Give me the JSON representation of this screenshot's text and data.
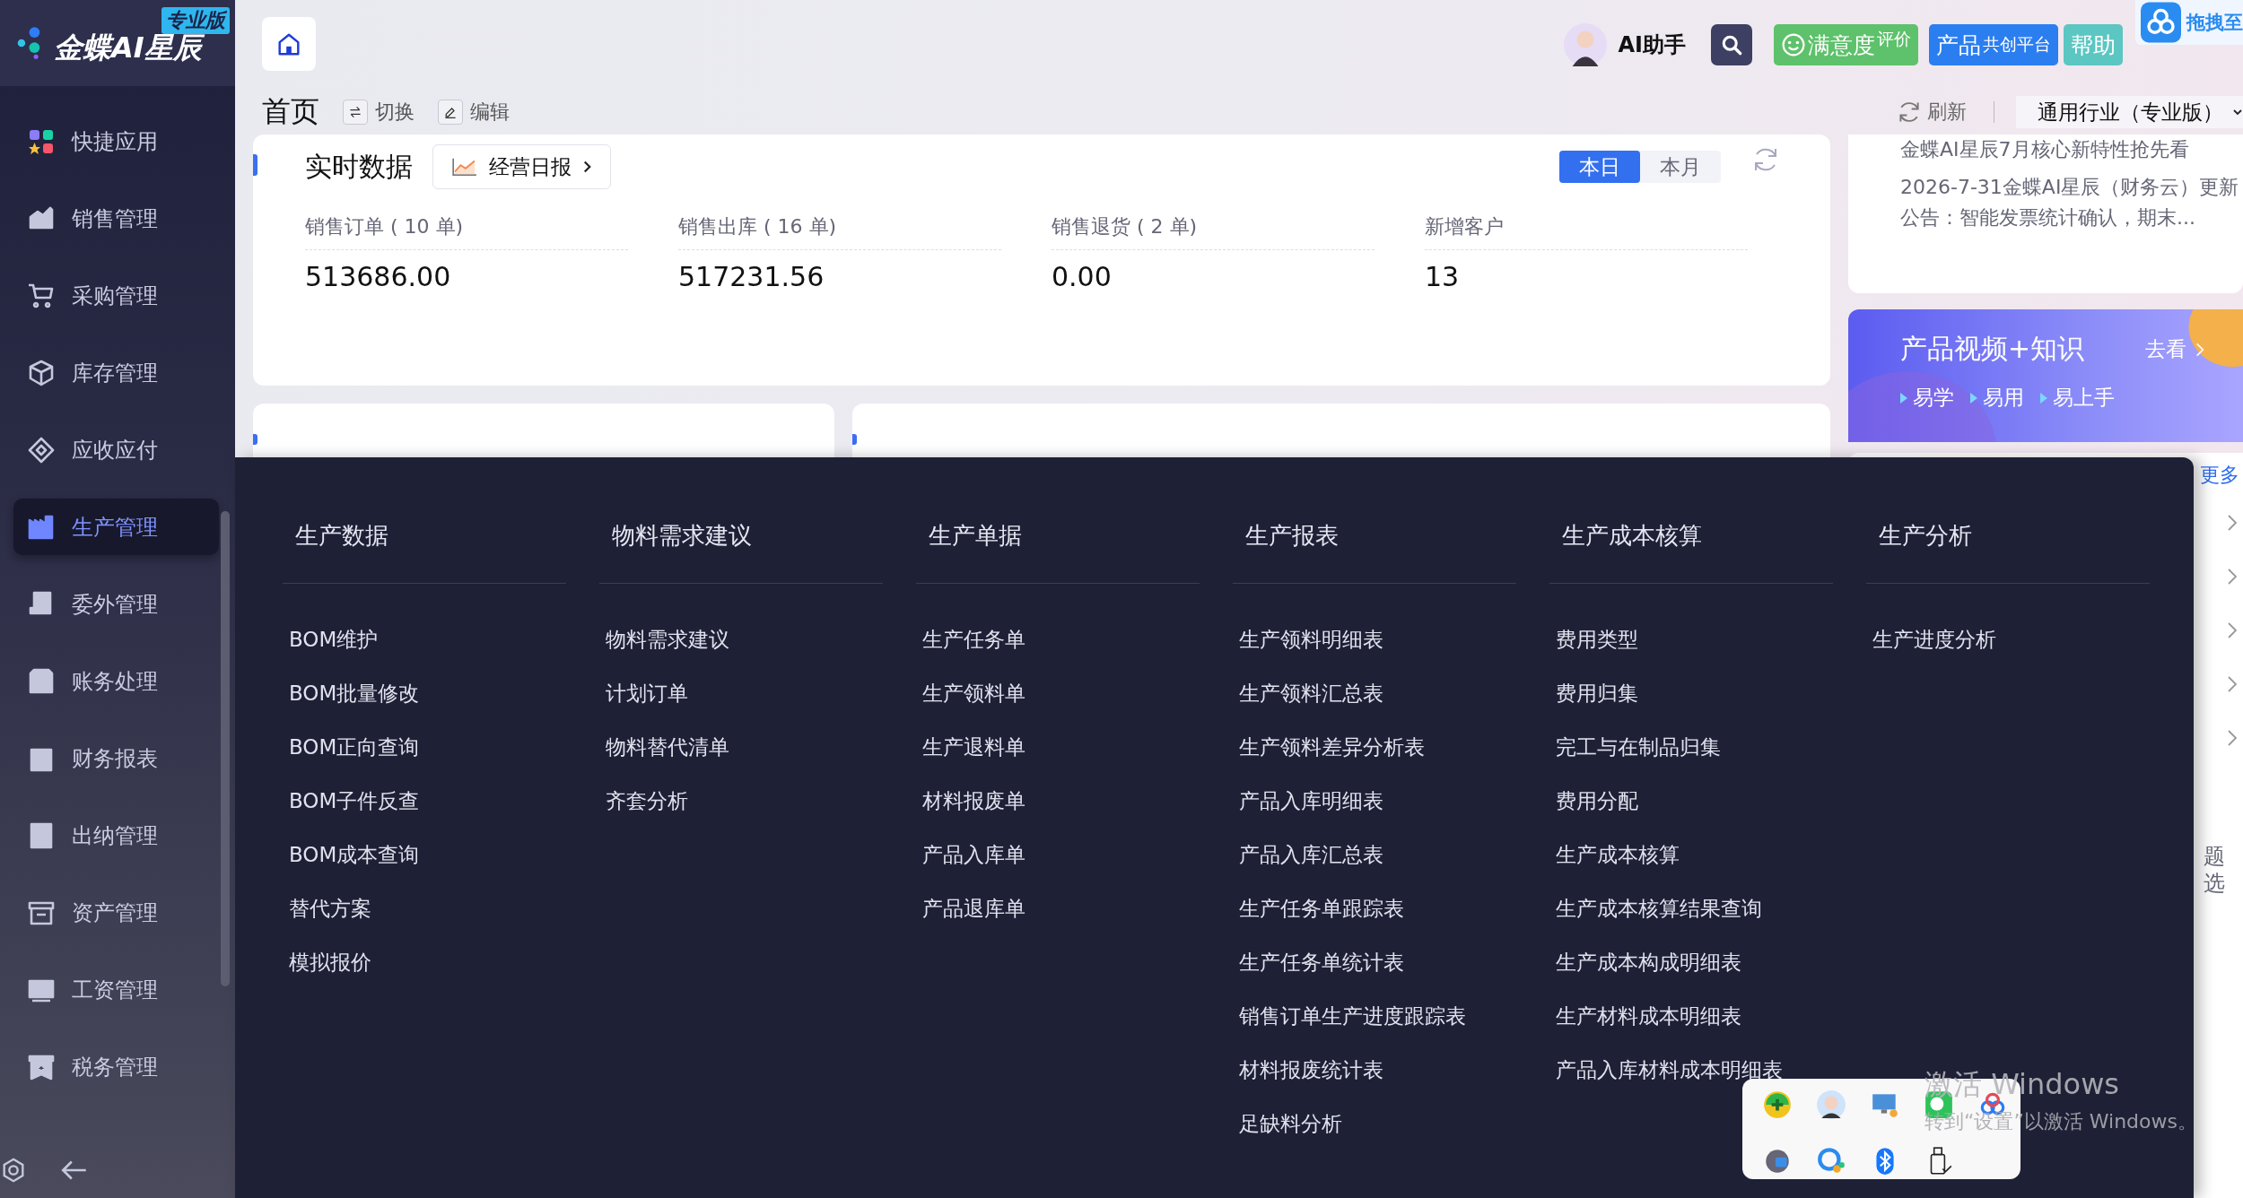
{
  "brand": {
    "name": "金蝶AI星辰",
    "edition": "专业版"
  },
  "sidebar": {
    "items": [
      {
        "label": "快捷应用",
        "selected": false
      },
      {
        "label": "销售管理",
        "selected": false
      },
      {
        "label": "采购管理",
        "selected": false
      },
      {
        "label": "库存管理",
        "selected": false
      },
      {
        "label": "应收应付",
        "selected": false
      },
      {
        "label": "生产管理",
        "selected": true
      },
      {
        "label": "委外管理",
        "selected": false
      },
      {
        "label": "账务处理",
        "selected": false
      },
      {
        "label": "财务报表",
        "selected": false
      },
      {
        "label": "出纳管理",
        "selected": false
      },
      {
        "label": "资产管理",
        "selected": false
      },
      {
        "label": "工资管理",
        "selected": false
      },
      {
        "label": "税务管理",
        "selected": false
      }
    ]
  },
  "header": {
    "page_title": "首页",
    "actions": [
      {
        "kind": "switch",
        "label": "切换"
      },
      {
        "kind": "edit",
        "label": "编辑"
      }
    ],
    "ai_assistant": "AI助手",
    "buttons": [
      {
        "kind": "rating",
        "label": "满意度",
        "small": "评价"
      },
      {
        "kind": "platform",
        "label": "产品",
        "small": "共创平台"
      },
      {
        "kind": "help",
        "label": "帮助"
      }
    ],
    "drag_hint": "拖拽至",
    "refresh": "刷新",
    "organization": "通用行业（专业版）"
  },
  "realtime": {
    "title": "实时数据",
    "report_button": "经营日报",
    "periods": [
      {
        "label": "本日",
        "selected": true
      },
      {
        "label": "本月",
        "selected": false
      }
    ],
    "metrics": [
      {
        "label": "销售订单 ( 10 单)",
        "value": "513686.00"
      },
      {
        "label": "销售出库 ( 16 单)",
        "value": "517231.56"
      },
      {
        "label": "销售退货 ( 2 单)",
        "value": "0.00"
      },
      {
        "label": "新增客户",
        "value": "13"
      }
    ]
  },
  "news": {
    "items": [
      "金蝶AI星辰7月核心新特性抢先看",
      "2026-7-31金蝶AI星辰（财务云）更新公告：智能发票统计确认，期末..."
    ]
  },
  "knowledge_banner": {
    "title": "产品视频+知识",
    "link": "去看",
    "tags": [
      "易学",
      "易用",
      "易上手"
    ]
  },
  "side_list": {
    "more": "更多",
    "fragments": [
      "题",
      "选"
    ]
  },
  "mega_menu": {
    "columns": [
      {
        "title": "生产数据",
        "items": [
          "BOM维护",
          "BOM批量修改",
          "BOM正向查询",
          "BOM子件反查",
          "BOM成本查询",
          "替代方案",
          "模拟报价"
        ]
      },
      {
        "title": "物料需求建议",
        "items": [
          "物料需求建议",
          "计划订单",
          "物料替代清单",
          "齐套分析"
        ]
      },
      {
        "title": "生产单据",
        "items": [
          "生产任务单",
          "生产领料单",
          "生产退料单",
          "材料报废单",
          "产品入库单",
          "产品退库单"
        ]
      },
      {
        "title": "生产报表",
        "items": [
          "生产领料明细表",
          "生产领料汇总表",
          "生产领料差异分析表",
          "产品入库明细表",
          "产品入库汇总表",
          "生产任务单跟踪表",
          "生产任务单统计表",
          "销售订单生产进度跟踪表",
          "材料报废统计表",
          "足缺料分析"
        ]
      },
      {
        "title": "生产成本核算",
        "items": [
          "费用类型",
          "费用归集",
          "完工与在制品归集",
          "费用分配",
          "生产成本核算",
          "生产成本核算结果查询",
          "生产成本构成明细表",
          "生产材料成本明细表",
          "产品入库材料成本明细表"
        ]
      },
      {
        "title": "生产分析",
        "items": [
          "生产进度分析"
        ]
      }
    ]
  },
  "watermark": {
    "title": "激活 Windows",
    "hint": "转到“设置”以激活 Windows。"
  }
}
